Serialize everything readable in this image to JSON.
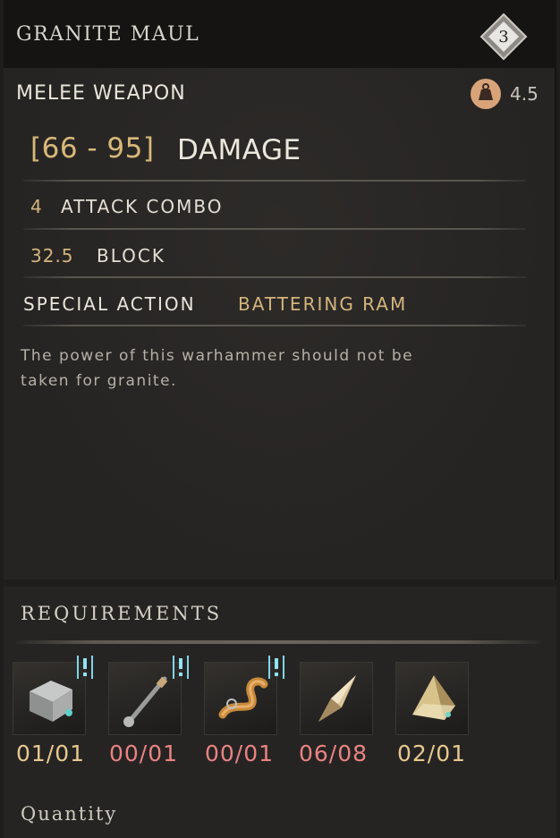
{
  "item": {
    "name": "GRANITE MAUL",
    "tier": "3",
    "type": "MELEE WEAPON",
    "weight": "4.5"
  },
  "stats": {
    "damage_range": "[66 - 95]",
    "damage_label": "DAMAGE",
    "combo_value": "4",
    "combo_label": "ATTACK COMBO",
    "block_value": "32.5",
    "block_label": "BLOCK",
    "special_label": "SPECIAL ACTION",
    "special_value": "BATTERING RAM"
  },
  "description_line1": "The power of this warhammer should not be",
  "description_line2": "taken for granite.",
  "requirements": {
    "title": "REQUIREMENTS",
    "items": [
      {
        "icon": "stone-block-icon",
        "count": "01/01",
        "color": "#e7c98f",
        "alert": true
      },
      {
        "icon": "metal-handle-icon",
        "count": "00/01",
        "color": "#e98383",
        "alert": true
      },
      {
        "icon": "leather-strap-icon",
        "count": "00/01",
        "color": "#e98383",
        "alert": true
      },
      {
        "icon": "crystal-shard-icon",
        "count": "06/08",
        "color": "#e98383",
        "alert": false
      },
      {
        "icon": "pyramid-gem-icon",
        "count": "02/01",
        "color": "#e7c98f",
        "alert": false
      }
    ]
  },
  "quantity_label": "Quantity",
  "colors": {
    "gold": "#d8b878",
    "insufficient": "#e98383",
    "sufficient": "#e7c98f"
  }
}
